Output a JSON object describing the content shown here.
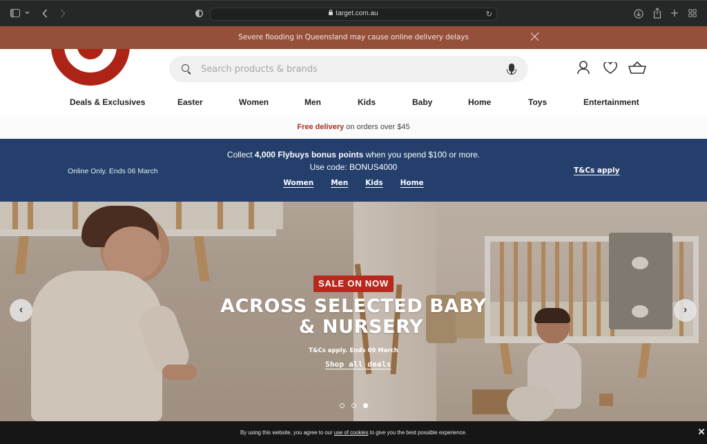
{
  "browser": {
    "url": "target.com.au",
    "icons": [
      "sidebar-icon",
      "chevron-down-icon",
      "back-icon",
      "forward-icon",
      "privacy-shield-icon",
      "lock-icon",
      "reload-icon",
      "download-icon",
      "share-icon",
      "new-tab-icon",
      "tab-overview-icon"
    ]
  },
  "alert": {
    "message": "Severe flooding in Queensland may cause online delivery delays"
  },
  "header": {
    "search_placeholder": "Search products & brands",
    "nav": [
      "Deals & Exclusives",
      "Easter",
      "Women",
      "Men",
      "Kids",
      "Baby",
      "Home",
      "Toys",
      "Entertainment"
    ]
  },
  "delivery": {
    "highlight": "Free delivery",
    "rest": " on orders over $45"
  },
  "promo": {
    "left": "Online Only. Ends 06 March",
    "line1_pre": "Collect ",
    "line1_bold": "4,000 Flybuys bonus points",
    "line1_post": " when you spend $100 or more.",
    "line2": "Use code: BONUS4000",
    "links": [
      "Women",
      "Men",
      "Kids",
      "Home"
    ],
    "terms": "T&Cs apply"
  },
  "hero": {
    "badge": "SALE ON NOW",
    "headline_1": "ACROSS SELECTED BABY",
    "headline_2": "& NURSERY",
    "subtext": "T&Cs apply. Ends 09 March",
    "cta": "Shop all deals",
    "prev": "‹",
    "next": "›",
    "slides_total": 3,
    "slide_active": 3
  },
  "cookie": {
    "pre": "By using this website, you agree to our ",
    "link": "use of cookies",
    "post": " to give you the best possible experience."
  },
  "colors": {
    "brand_red": "#b8281c",
    "alert_bg": "#94503a",
    "promo_bg": "#243f6c"
  }
}
